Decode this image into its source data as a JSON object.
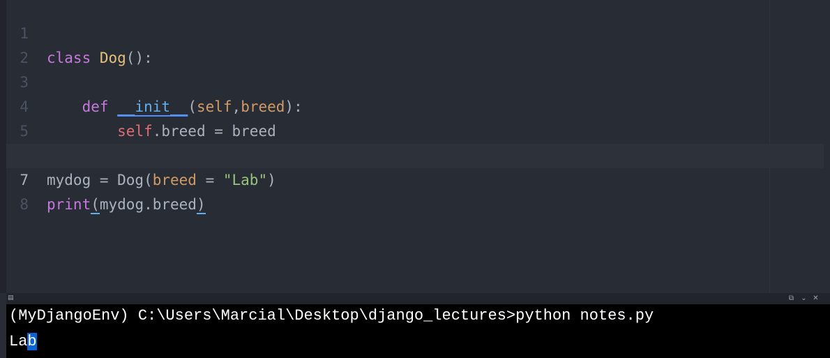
{
  "editor": {
    "active_line": 7,
    "lines": [
      {
        "num": "1",
        "tokens": {
          "kw": "class ",
          "cls": "Dog",
          "rest": "():"
        }
      },
      {
        "num": "2"
      },
      {
        "num": "3",
        "tokens": {
          "indent": "    ",
          "kw": "def ",
          "fn": "__init__",
          "open": "(",
          "self": "self",
          "comma": ",",
          "arg": "breed",
          "close": "):"
        }
      },
      {
        "num": "4",
        "tokens": {
          "indent": "        ",
          "self": "self",
          "rest": ".breed = breed"
        }
      },
      {
        "num": "5"
      },
      {
        "num": "6",
        "tokens": {
          "a": "mydog = Dog(",
          "arg": "breed",
          "eq": " = ",
          "str": "\"Lab\"",
          "close": ")"
        }
      },
      {
        "num": "7",
        "tokens": {
          "kw": "print",
          "open": "(",
          "body": "mydog.breed",
          "close": ")"
        }
      },
      {
        "num": "8"
      }
    ]
  },
  "terminal": {
    "prompt_line": "(MyDjangoEnv) C:\\Users\\Marcial\\Desktop\\django_lectures>python notes.py",
    "output_plain": "La",
    "output_selected": "b"
  },
  "icons": {
    "terminal_panel": "terminal-icon",
    "maximize": "maximize-icon",
    "collapse": "chevron-down-icon",
    "close": "close-icon"
  },
  "colors": {
    "editor_bg": "#282c34",
    "terminal_bg": "#000000",
    "keyword": "#c678dd",
    "class_name": "#e5c07b",
    "function": "#61afef",
    "self": "#e06c75",
    "parameter": "#d19a66",
    "string": "#98c379",
    "selection": "#0a64d6"
  }
}
